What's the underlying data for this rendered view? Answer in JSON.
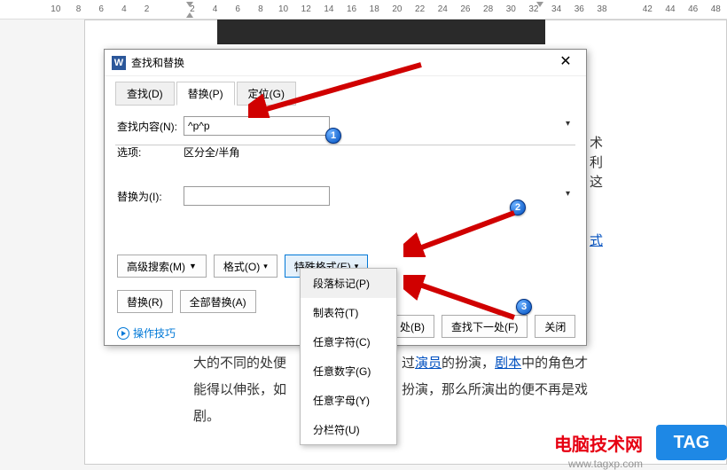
{
  "ruler": {
    "ticks": [
      "10",
      "8",
      "6",
      "4",
      "2",
      "",
      "2",
      "4",
      "6",
      "8",
      "10",
      "12",
      "14",
      "16",
      "18",
      "20",
      "22",
      "24",
      "26",
      "28",
      "30",
      "32",
      "34",
      "36",
      "38",
      "",
      "42",
      "44",
      "46",
      "48"
    ]
  },
  "dialog": {
    "title": "查找和替换",
    "tabs": {
      "find": "查找(D)",
      "replace": "替换(P)",
      "goto": "定位(G)"
    },
    "find_label": "查找内容(N):",
    "find_value": "^p^p",
    "options_label": "选项:",
    "options_value": "区分全/半角",
    "replace_label": "替换为(I):",
    "replace_value": "",
    "adv_search": "高级搜索(M)",
    "format": "格式(O)",
    "special": "特殊格式(E)",
    "replace_btn": "替换(R)",
    "replace_all": "全部替换(A)",
    "find_next": "查找下一处(F)",
    "close": "关闭",
    "tips": "操作技巧",
    "find_prev_fragment": "处(B)"
  },
  "dropdown": {
    "paragraph": "段落标记(P)",
    "tab": "制表符(T)",
    "anychar": "任意字符(C)",
    "anydigit": "任意数字(G)",
    "anyletter": "任意字母(Y)",
    "column": "分栏符(U)"
  },
  "badges": {
    "b1": "1",
    "b2": "2",
    "b3": "3"
  },
  "bg": {
    "t1": "术",
    "t2": "利",
    "t3": "这",
    "t4": "式"
  },
  "body": {
    "line1a": "大的不同的处便",
    "line1b": "过",
    "link1": "演员",
    "line1c": "的扮演，",
    "link2": "剧本",
    "line1d": "中的角色才",
    "line2a": "能得以伸张，如",
    "line2b": "扮演，那么所演出的便不再是戏",
    "line3": "剧。"
  },
  "watermark": {
    "text": "电脑技术网",
    "url": "www.tagxp.com",
    "tag": "TAG"
  }
}
